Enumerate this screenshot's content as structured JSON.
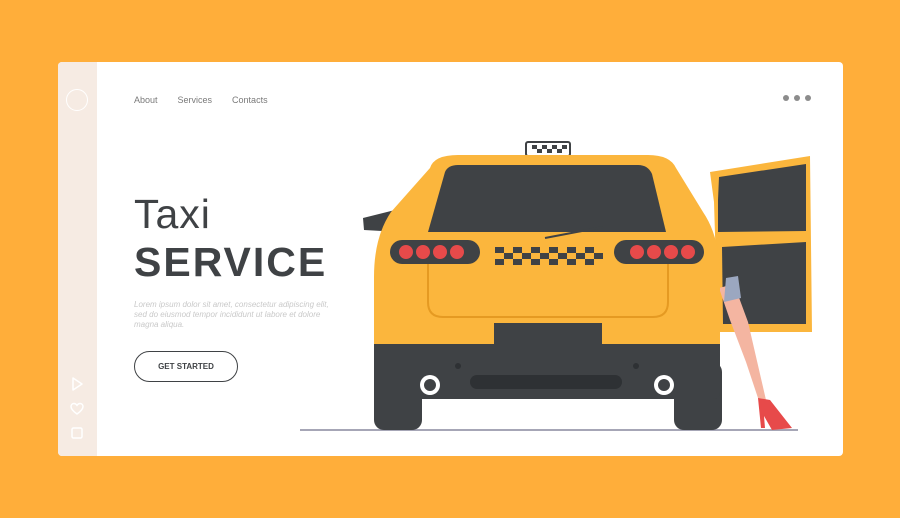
{
  "nav": {
    "about": "About",
    "services": "Services",
    "contacts": "Contacts"
  },
  "hero": {
    "title": "Taxi",
    "subtitle": "SERVICE",
    "description": "Lorem ipsum dolor sit amet, consectetur adipiscing elit, sed do eiusmod tempor incididunt ut labore et dolore magna aliqua.",
    "cta": "GET STARTED"
  },
  "icons": {
    "sidebar": [
      "circle-icon",
      "play-icon",
      "heart-icon",
      "square-icon"
    ],
    "header": "more-dots-icon"
  },
  "colors": {
    "background": "#FFAE3A",
    "card": "#FFFFFF",
    "sidebar": "#F6EBE3",
    "taxi_yellow": "#FBB63D",
    "dark": "#3F4245",
    "taillight": "#E74A4A"
  }
}
